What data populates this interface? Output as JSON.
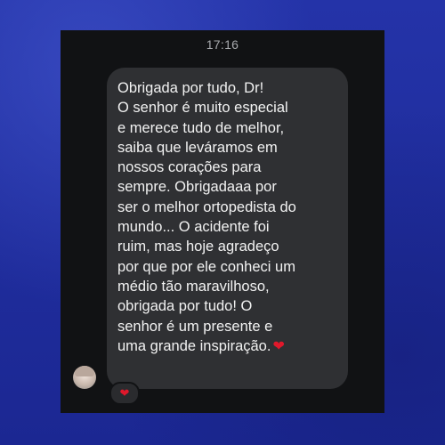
{
  "chat": {
    "time": "17:16",
    "message": "Obrigada por tudo, Dr!\nO senhor é muito especial\ne merece tudo de melhor,\nsaiba que leváramos em\nnossos corações para\nsempre. Obrigadaaa por\nser o melhor ortopedista do\nmundo... O acidente foi\nruim, mas hoje agradeço\npor que por ele conheci um\nmédio tão maravilhoso,\nobrigada por tudo! O\nsenhor é um presente e\numa grande inspiração.",
    "message_emoji": "❤",
    "reaction": "❤",
    "colors": {
      "background": "#1f2b9c",
      "screen": "#111214",
      "bubble": "#2f3033",
      "text": "#f2f2f2",
      "heart": "#e0182b"
    },
    "icons": [
      "avatar",
      "heart-icon",
      "heart-reaction-icon"
    ]
  }
}
